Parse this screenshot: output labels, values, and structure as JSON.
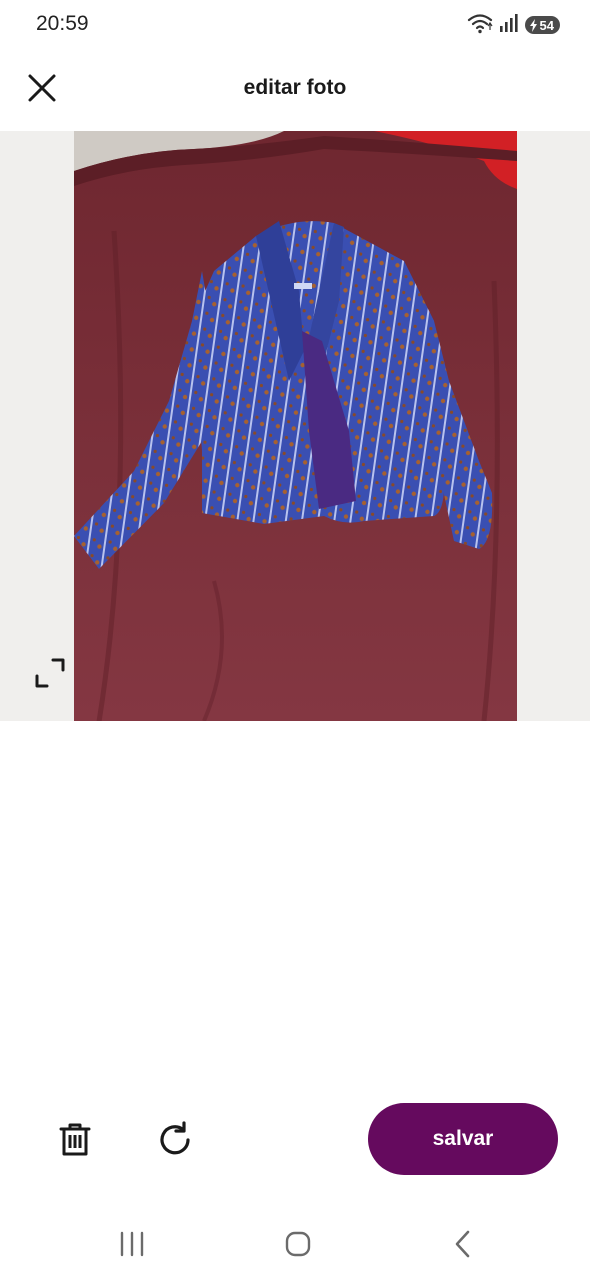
{
  "status_bar": {
    "time": "20:59",
    "battery_level": "54",
    "icons": [
      "wifi-icon",
      "signal-icon",
      "battery-charging-icon"
    ]
  },
  "header": {
    "title": "editar foto",
    "close_icon": "close-icon"
  },
  "photo": {
    "description_icon": "photo",
    "resize_icon": "crop-resize-icon"
  },
  "actions": {
    "delete_icon": "trash-icon",
    "rotate_icon": "rotate-icon",
    "save_label": "salvar"
  },
  "navigation": {
    "icons": [
      "recent-apps-icon",
      "home-icon",
      "back-icon"
    ]
  },
  "colors": {
    "accent": "#650a5e",
    "photo_background": "#f0efed",
    "icon": "#1a1a1a"
  }
}
